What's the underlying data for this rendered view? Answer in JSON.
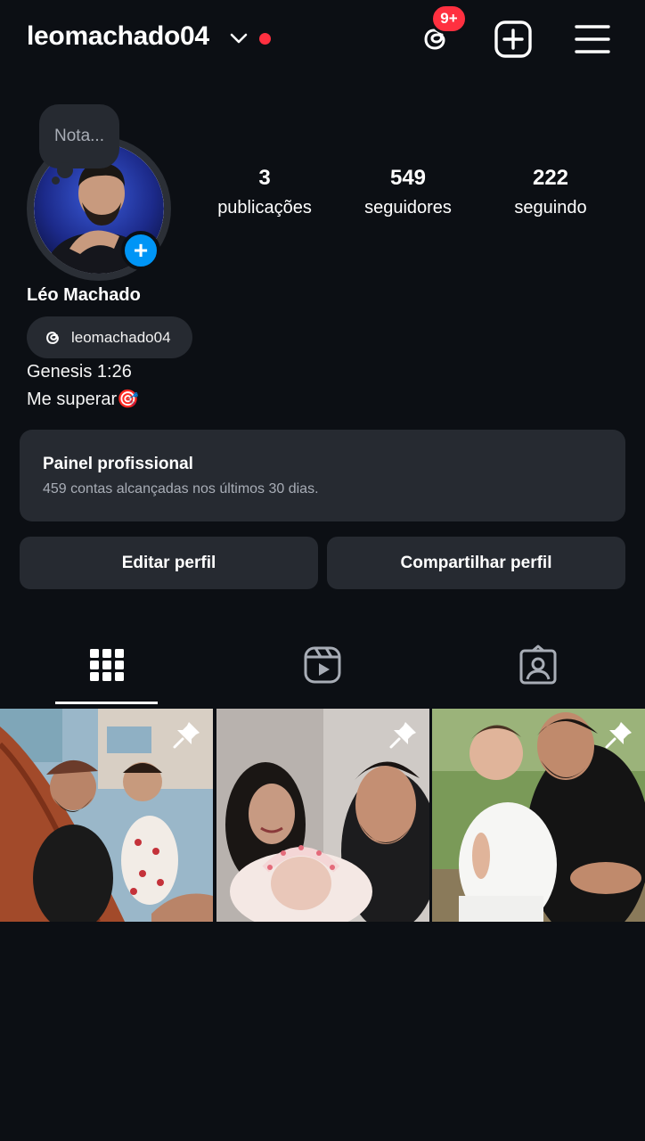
{
  "header": {
    "username": "leomachado04",
    "notification_badge": "9+",
    "live_indicator_color": "#ff3040",
    "icons": [
      "chevron-down-icon",
      "threads-icon",
      "add-square-icon",
      "hamburger-menu-icon"
    ]
  },
  "profile": {
    "note_placeholder": "Nota...",
    "full_name": "Léo Machado",
    "threads_handle": "leomachado04",
    "bio_lines": [
      "Genesis 1:26",
      "Me superar🎯"
    ],
    "stats": [
      {
        "value": "3",
        "label": "publicações"
      },
      {
        "value": "549",
        "label": "seguidores"
      },
      {
        "value": "222",
        "label": "seguindo"
      }
    ]
  },
  "dashboard": {
    "title": "Painel profissional",
    "subtitle": "459 contas alcançadas nos últimos 30 dias."
  },
  "actions": {
    "edit_label": "Editar perfil",
    "share_label": "Compartilhar perfil"
  },
  "tabs": [
    {
      "icon": "grid-icon",
      "selected": true
    },
    {
      "icon": "reels-icon",
      "selected": false
    },
    {
      "icon": "tagged-icon",
      "selected": false
    }
  ],
  "posts": [
    {
      "pinned": true,
      "subject": "man-with-baby-in-hammock"
    },
    {
      "pinned": true,
      "subject": "family-with-newborn"
    },
    {
      "pinned": true,
      "subject": "man-with-baby-white-dress"
    }
  ],
  "colors": {
    "background": "#0c0f14",
    "surface": "#262a31",
    "accent_blue": "#0095f6",
    "badge_red": "#ff3040",
    "secondary_text": "#a8adb6"
  }
}
